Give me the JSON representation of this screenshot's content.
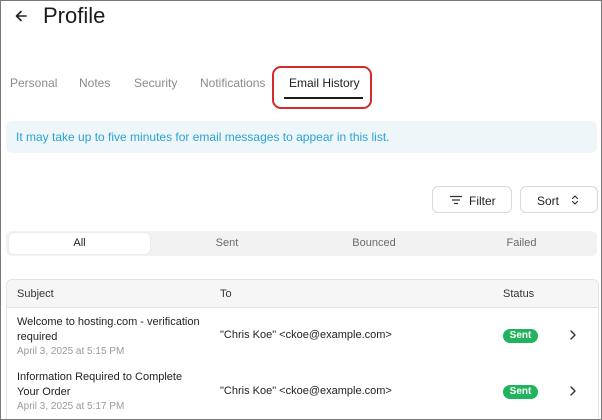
{
  "header": {
    "title": "Profile"
  },
  "tabs": [
    {
      "label": "Personal"
    },
    {
      "label": "Notes"
    },
    {
      "label": "Security"
    },
    {
      "label": "Notifications"
    },
    {
      "label": "Email History"
    }
  ],
  "active_tab": "Email History",
  "info_banner": {
    "text": "It may take up to five minutes for email messages to appear in this list."
  },
  "toolbar": {
    "filter_label": "Filter",
    "sort_label": "Sort"
  },
  "segments": [
    {
      "label": "All"
    },
    {
      "label": "Sent"
    },
    {
      "label": "Bounced"
    },
    {
      "label": "Failed"
    }
  ],
  "active_segment": "All",
  "table": {
    "columns": {
      "subject": "Subject",
      "to": "To",
      "status": "Status"
    },
    "rows": [
      {
        "subject_line1": "Welcome to hosting.com - verification",
        "subject_line2": "required",
        "date": "April 3, 2025 at 5:15 PM",
        "to": "\"Chris Koe\" <ckoe@example.com>",
        "status": "Sent"
      },
      {
        "subject_line1": "Information Required to Complete",
        "subject_line2": "Your Order",
        "date": "April 3, 2025 at 5:17 PM",
        "to": "\"Chris Koe\" <ckoe@example.com>",
        "status": "Sent"
      }
    ]
  },
  "colors": {
    "accent_text": "#2aa3d6",
    "banner_bg": "#eef6fa",
    "status_sent": "#22b35e",
    "highlight": "#d32b2b"
  },
  "icons": {
    "back": "arrow-left-icon",
    "filter": "filter-lines-icon",
    "sort": "sort-updown-icon",
    "row_chevron": "chevron-right-icon"
  }
}
